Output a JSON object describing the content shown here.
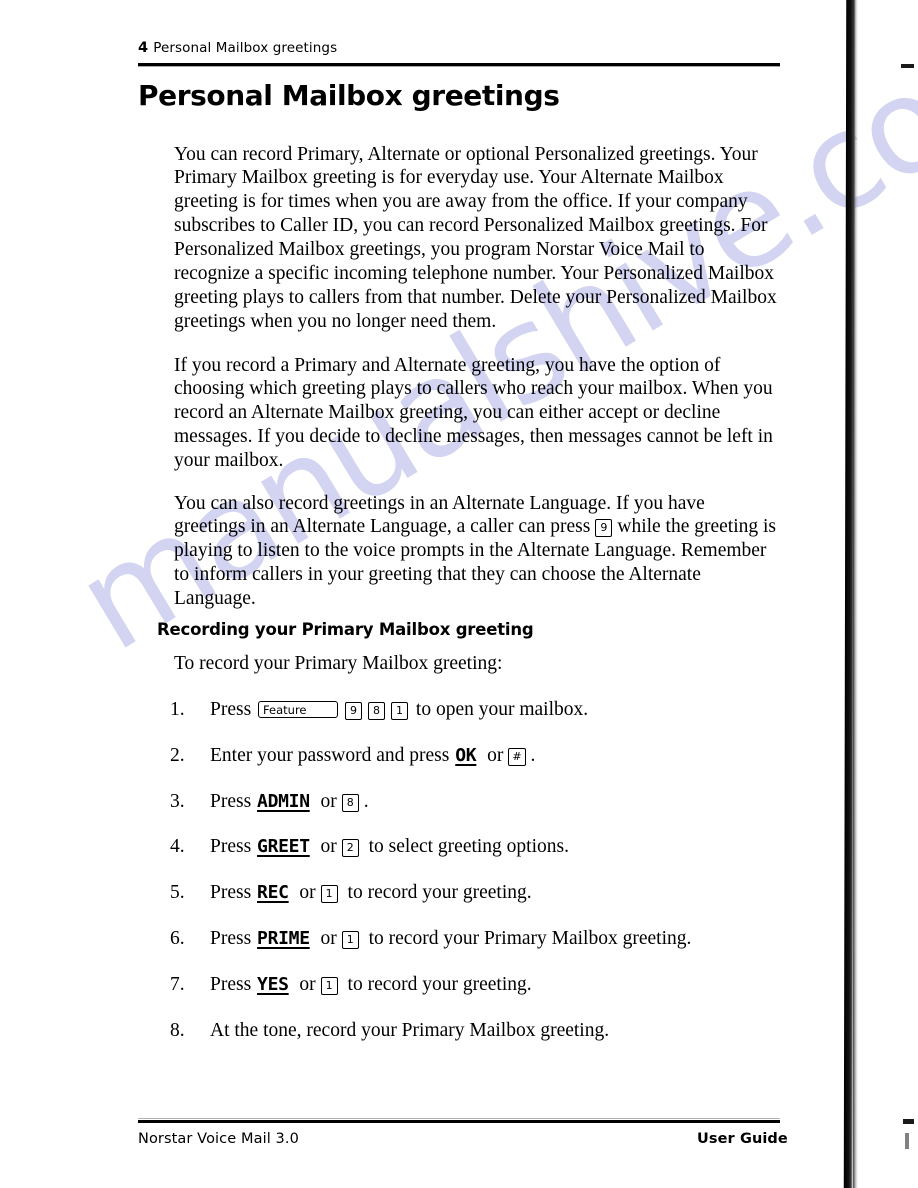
{
  "document": {
    "running_head": {
      "page_number": "4",
      "section": "Personal Mailbox greetings"
    },
    "title": "Personal Mailbox greetings",
    "paragraphs": [
      "You can record Primary, Alternate or optional Personalized greetings.  Your Primary Mailbox greeting is for everyday use. Your Alternate Mailbox greeting is for times when you are away from the office. If your company subscribes to Caller ID, you can record Personalized Mailbox  greetings. For Personalized Mailbox greetings, you program Norstar Voice Mail to recognize a specific incoming telephone number. Your Personalized Mailbox greeting plays to callers from that number. Delete your Personalized Mailbox greetings when you no longer need them.",
      "If you record a Primary and Alternate greeting, you have the option of choosing which greeting plays to callers who reach your mailbox. When you record an Alternate Mailbox greeting, you can either accept or decline messages. If you decide to decline messages, then messages cannot be left in your mailbox."
    ],
    "paragraph_3": {
      "before_key": "You can also record greetings in an Alternate Language. If you have greetings in an Alternate Language, a caller can press",
      "key": "9",
      "after_key": "while the greeting is playing to listen to the voice prompts in the Alternate Language. Remember to inform callers in your greeting that they can choose the Alternate Language."
    },
    "subsection": {
      "heading": "Recording your Primary Mailbox greeting",
      "lead_in": "To record your Primary Mailbox greeting:"
    },
    "steps": [
      {
        "number": "1.",
        "pre": "Press",
        "feature_button": "Feature",
        "keys": [
          "9",
          "8",
          "1"
        ],
        "post": "to open your mailbox."
      },
      {
        "number": "2.",
        "pre": "Enter your password and press",
        "display_label": "OK",
        "conjunction": "or",
        "keys": [
          "#"
        ],
        "post": "."
      },
      {
        "number": "3.",
        "pre": "Press",
        "display_label": "ADMIN",
        "conjunction": "or",
        "keys": [
          "8"
        ],
        "post": "."
      },
      {
        "number": "4.",
        "pre": "Press",
        "display_label": "GREET",
        "conjunction": "or",
        "keys": [
          "2"
        ],
        "post": "to select greeting options."
      },
      {
        "number": "5.",
        "pre": "Press",
        "display_label": "REC",
        "conjunction": "or",
        "keys": [
          "1"
        ],
        "post": "to record your greeting."
      },
      {
        "number": "6.",
        "pre": "Press",
        "display_label": "PRIME",
        "conjunction": "or",
        "keys": [
          "1"
        ],
        "post": "to record your Primary Mailbox greeting."
      },
      {
        "number": "7.",
        "pre": "Press",
        "display_label": "YES",
        "conjunction": "or",
        "keys": [
          "1"
        ],
        "post": "to record your greeting."
      },
      {
        "number": "8.",
        "pre": "At the tone, record your Primary Mailbox greeting.",
        "display_label": "",
        "conjunction": "",
        "keys": [],
        "post": ""
      }
    ],
    "footer": {
      "left": "Norstar Voice Mail 3.0",
      "right": "User Guide"
    },
    "watermark": "manualshive.com",
    "colors": {
      "watermark": "#ccccf0",
      "ink": "#000000",
      "paper": "#ffffff"
    }
  }
}
